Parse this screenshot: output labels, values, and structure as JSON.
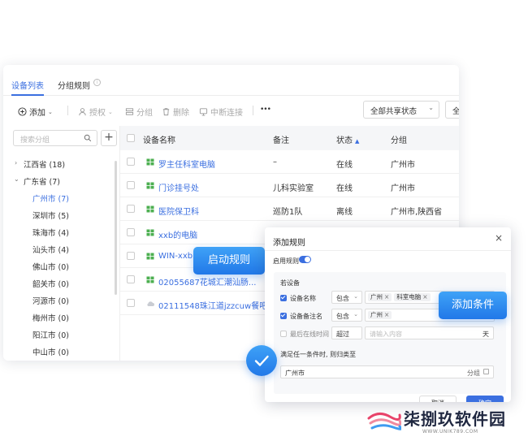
{
  "tabs": [
    {
      "label": "设备列表",
      "active": true
    },
    {
      "label": "分组规则",
      "active": false
    }
  ],
  "toolbar": {
    "add": "添加",
    "authorize": "授权",
    "group": "分组",
    "delete": "删除",
    "disconnect": "中断连接",
    "more": "•••",
    "share_filter": "全部共享状态",
    "extra_filter": "全"
  },
  "sidebar": {
    "search_placeholder": "搜索分组",
    "add": "+",
    "provinces": [
      {
        "label": "江西省  (18)",
        "expanded": false
      },
      {
        "label": "广东省  (7)",
        "expanded": true
      }
    ],
    "cities": [
      {
        "label": "广州市  (7)",
        "selected": true
      },
      {
        "label": "深圳市  (5)"
      },
      {
        "label": "珠海市  (4)"
      },
      {
        "label": "汕头市  (4)"
      },
      {
        "label": "佛山市  (0)"
      },
      {
        "label": "韶关市  (0)"
      },
      {
        "label": "河源市  (0)"
      },
      {
        "label": "梅州市  (0)"
      },
      {
        "label": "阳江市  (0)"
      },
      {
        "label": "中山市  (0)"
      }
    ]
  },
  "table": {
    "headers": {
      "name": "设备名称",
      "remark": "备注",
      "status": "状态",
      "group": "分组"
    },
    "rows": [
      {
        "name": "罗主任科室电脑",
        "remark": "–",
        "status": "在线",
        "group": "广州市",
        "icon": "windows"
      },
      {
        "name": "门诊挂号处",
        "remark": "儿科实验室",
        "status": "在线",
        "group": "广州市",
        "icon": "windows"
      },
      {
        "name": "医院保卫科",
        "remark": "巡防1队",
        "status": "离线",
        "group": "广州市,陕西省",
        "icon": "windows"
      },
      {
        "name": "xxb的电脑",
        "remark": "",
        "status": "",
        "group": "",
        "icon": "windows"
      },
      {
        "name": "WIN-xxb",
        "remark": "",
        "status": "",
        "group": "",
        "icon": "windows"
      },
      {
        "name": "02055687花城汇潮汕肠...",
        "remark": "",
        "status": "",
        "group": "",
        "icon": "windows"
      },
      {
        "name": "02111548珠江道jzzcuw餐吧",
        "remark": "",
        "status": "",
        "group": "",
        "icon": "cloud"
      }
    ]
  },
  "dialog": {
    "title": "添加规则",
    "close": "×",
    "enable_label": "启用规则",
    "if_label": "若设备",
    "conditions": [
      {
        "label": "设备名称",
        "checked": true,
        "op": "包含",
        "tags": [
          "广州",
          "科室电脑"
        ]
      },
      {
        "label": "设备备注名",
        "checked": true,
        "op": "包含",
        "tags": [
          "广州"
        ]
      },
      {
        "label": "最后在线时间",
        "checked": false,
        "op": "超过",
        "placeholder": "请输入内容",
        "unit": "天"
      }
    ],
    "then_label": "满足任一条件时, 则归类至",
    "target_value": "广州市",
    "target_suffix": "分组",
    "cancel": "取消",
    "ok": "确定"
  },
  "callouts": {
    "start_rule": "启动规则",
    "add_condition": "添加条件"
  },
  "watermark": {
    "name": "柒捌玖软件园",
    "url": "WWW.UNIK789.COM"
  },
  "colors": {
    "accent": "#3b6fe0",
    "callout": "#2178e8"
  }
}
